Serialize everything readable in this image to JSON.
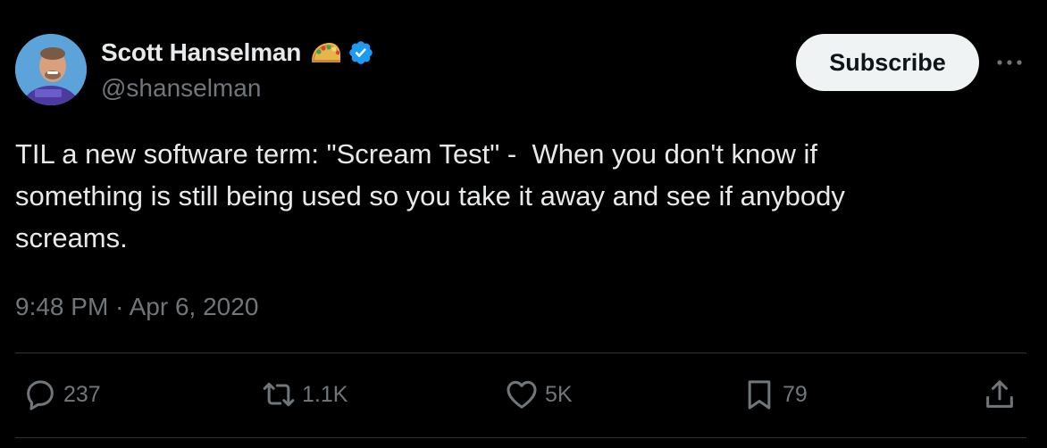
{
  "author": {
    "display_name": "Scott Hanselman",
    "handle": "@shanselman",
    "avatar_icon": "avatar-photo",
    "name_emoji": "taco-icon",
    "badge": "verified-icon",
    "badge_color": "#1d9bf0"
  },
  "header": {
    "subscribe_label": "Subscribe",
    "more_icon": "more-icon"
  },
  "tweet": {
    "text": "TIL a new software term: \"Scream Test\" -  When you don't know if\nsomething is still being used so you take it away and see if anybody\nscreams.",
    "timestamp": "9:48 PM · Apr 6, 2020"
  },
  "actions": {
    "replies": "237",
    "retweets": "1.1K",
    "likes": "5K",
    "bookmarks": "79"
  },
  "colors": {
    "background": "#000000",
    "primary_text": "#e7e9ea",
    "secondary_text": "#71767b",
    "divider": "#2f3336",
    "button_bg": "#eff3f4",
    "button_text": "#0f1419"
  }
}
